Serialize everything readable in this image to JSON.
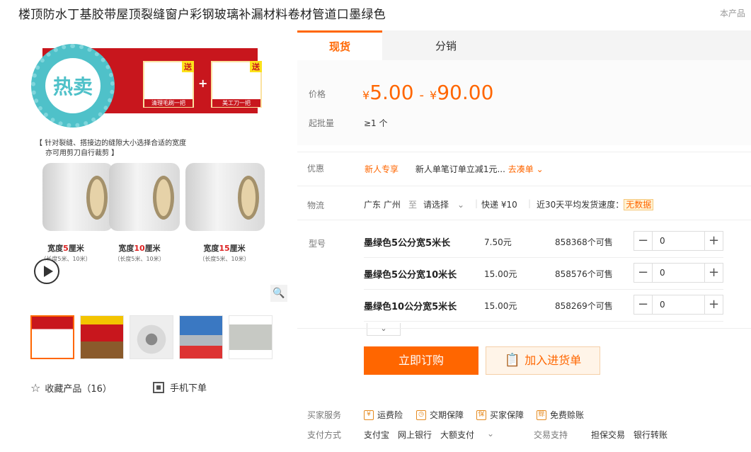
{
  "product": {
    "title": "楼顶防水丁基胶带屋顶裂缝窗户彩钢玻璃补漏材料卷材管道口墨绿色",
    "corner_text": "本产品"
  },
  "gallery": {
    "badge_text": "热卖",
    "gift1_tag": "送",
    "gift1_caption": "清理毛刷一把",
    "gift2_tag": "送",
    "gift2_caption": "美工刀一把",
    "plus": "+",
    "note_line1": "【 针对裂缝、搭接边的缝隙大小选择合适的宽度",
    "note_line2": "亦可用剪刀自行裁剪 】",
    "rolls": [
      {
        "pre": "宽度",
        "num": "5",
        "post": "厘米",
        "sub": "（长度5米、10米）"
      },
      {
        "pre": "宽度",
        "num": "10",
        "post": "厘米",
        "sub": "（长度5米、10米）"
      },
      {
        "pre": "宽度",
        "num": "15",
        "post": "厘米",
        "sub": "（长度5米、10米）"
      }
    ]
  },
  "actions": {
    "favorite": "收藏产品（16）",
    "mobile_order": "手机下单"
  },
  "tabs": {
    "spot": "现货",
    "distribution": "分销"
  },
  "price": {
    "label": "价格",
    "currency": "¥",
    "min": "5.00",
    "dash": "-",
    "max": "90.00",
    "moq_label": "起批量",
    "moq": "≥1 个"
  },
  "promo": {
    "label": "优惠",
    "tag": "新人专享",
    "text": "新人单笔订单立减1元...",
    "link": "去凑单"
  },
  "logistics": {
    "label": "物流",
    "from": "广东 广州",
    "to_word": "至",
    "dest": "请选择",
    "express": "快递 ¥10",
    "speed_label": "近30天平均发货速度：",
    "speed_value": "无数据"
  },
  "variants": {
    "label": "型号",
    "rows": [
      {
        "name": "墨绿色5公分宽5米长",
        "price": "7.50元",
        "stock": "858368个可售",
        "qty": "0"
      },
      {
        "name": "墨绿色5公分宽10米长",
        "price": "15.00元",
        "stock": "858576个可售",
        "qty": "0"
      },
      {
        "name": "墨绿色10公分宽5米长",
        "price": "15.00元",
        "stock": "858269个可售",
        "qty": "0"
      }
    ]
  },
  "buttons": {
    "buy": "立即订购",
    "cart": "加入进货单"
  },
  "services": {
    "label": "买家服务",
    "items": [
      "运费险",
      "交期保障",
      "买家保障",
      "免费赊账"
    ]
  },
  "payment": {
    "label": "支付方式",
    "methods": "支付宝　网上银行　大额支付",
    "trade_label": "交易支持",
    "trade": "担保交易　银行转账"
  },
  "colors": {
    "accent": "#ff6600",
    "banner_red": "#c8161d",
    "badge_teal": "#4fc1c9"
  },
  "icons": [
    "play-icon",
    "zoom-icon",
    "star-icon",
    "qr-icon",
    "chevron-down-icon",
    "minus-icon",
    "plus-icon",
    "clipboard-icon"
  ]
}
